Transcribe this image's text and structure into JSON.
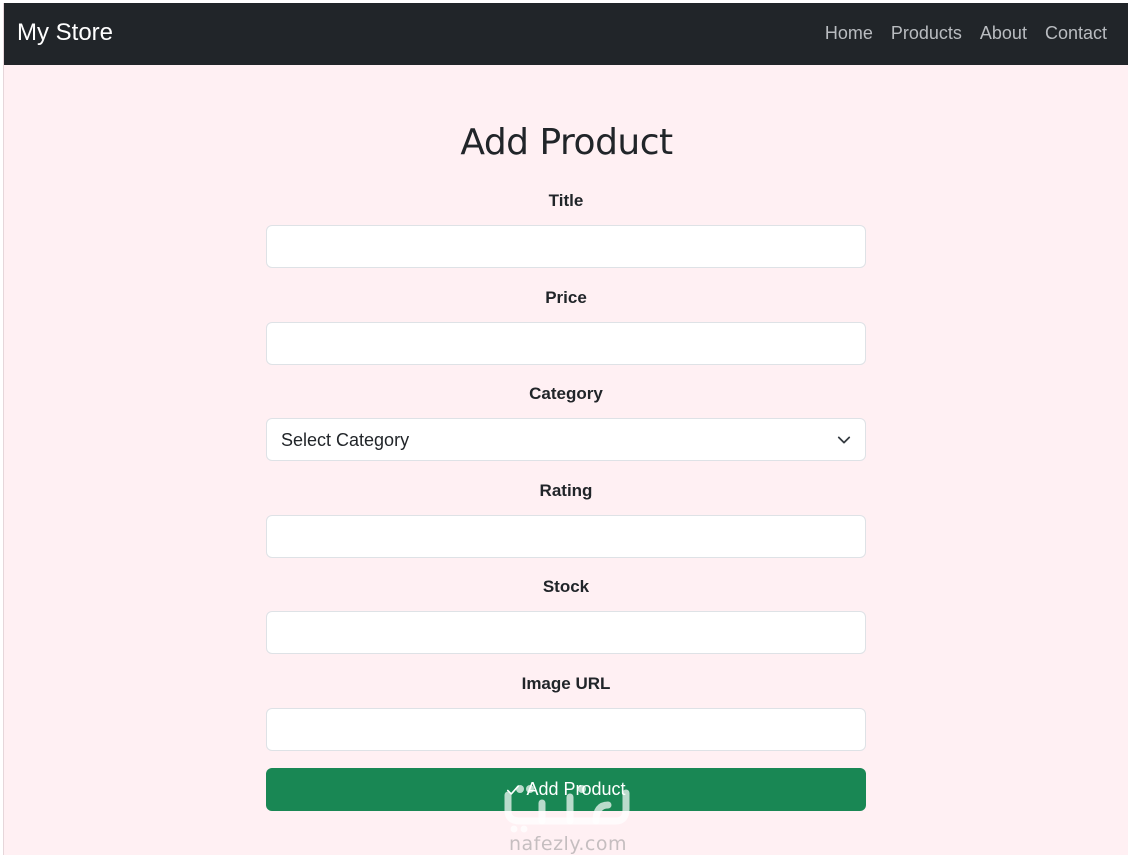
{
  "navbar": {
    "brand": "My Store",
    "links": [
      "Home",
      "Products",
      "About",
      "Contact"
    ]
  },
  "page": {
    "title": "Add Product"
  },
  "form": {
    "title_label": "Title",
    "title_value": "",
    "price_label": "Price",
    "price_value": "",
    "category_label": "Category",
    "category_selected": "Select Category",
    "rating_label": "Rating",
    "rating_value": "",
    "stock_label": "Stock",
    "stock_value": "",
    "image_url_label": "Image URL",
    "image_url_value": "",
    "submit_label": "Add Product"
  },
  "watermark": {
    "text": "nafezly.com"
  },
  "colors": {
    "navbar_bg": "#212529",
    "page_bg": "#fff0f3",
    "submit_bg": "#198754",
    "nav_link": "#b9bcc0"
  },
  "icons": {
    "select_chevron": "chevron-down-icon",
    "submit_check": "check-icon"
  }
}
